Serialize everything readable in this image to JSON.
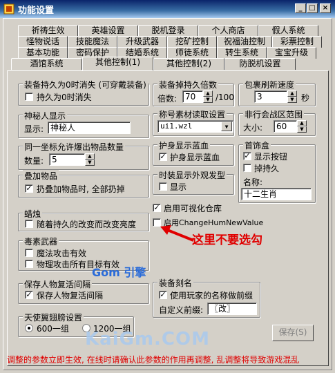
{
  "window": {
    "title": "功能设置"
  },
  "tabs_rows": [
    [
      "祈祷生效",
      "英雄设置",
      "脱机登录",
      "个人商店",
      "假人系统"
    ],
    [
      "怪物说话",
      "技能魔法",
      "升级武器",
      "挖矿控制",
      "祝福油控制",
      "彩票控制"
    ],
    [
      "基本功能",
      "密码保护",
      "结婚系统",
      "师徒系统",
      "转生系统",
      "宝宝升级"
    ],
    [
      "酒馆系统",
      "其他控制(1)",
      "其他控制(2)",
      "防脱机设置"
    ]
  ],
  "groups": {
    "durability": {
      "title": "装备持久为0时消失 (可穿戴装备)",
      "check_label": "持久为0时消失",
      "checked": false
    },
    "mystery": {
      "title": "神秘人显示",
      "label": "显示:",
      "value": "神秘人"
    },
    "same_coord": {
      "title": "同一坐标允许爆出物品数量",
      "label": "数量:",
      "value": "5"
    },
    "stack": {
      "title": "叠加物品",
      "check_label": "扔叠加物品时, 全部扔掉",
      "checked": true
    },
    "candle": {
      "title": "蜡烛",
      "check_label": "随着持久的改变而改变亮度",
      "checked": false
    },
    "poison": {
      "title": "毒素武器",
      "check1": "魔法攻击有效",
      "check1_checked": false,
      "check2": "物理攻击所有目标有效",
      "check2_checked": false
    },
    "revive": {
      "title": "保存人物复活间隔",
      "check_label": "保存人物复活间隔",
      "checked": true
    },
    "angel": {
      "title": "天使翼翅膀设置",
      "radio1": "600一组",
      "radio2": "1200一组",
      "selected": "600一组"
    },
    "drop_rate": {
      "title": "装备掉持久倍数",
      "label": "倍数:",
      "value": "70",
      "suffix": "/100"
    },
    "title_read": {
      "title": "称号素材读取设置",
      "value": "ui1.wzl"
    },
    "guard": {
      "title": "护身显示蓝血",
      "check_label": "护身显示蓝血",
      "checked": true
    },
    "fashion": {
      "title": "时装显示外观发型",
      "check_label": "显示",
      "checked": false
    },
    "pack_refresh": {
      "title": "包裹刷新速度",
      "value": "3",
      "unit": "秒"
    },
    "non_pk": {
      "title": "非行会战区范围",
      "label": "大小:",
      "value": "60"
    },
    "jewelry": {
      "title": "首饰盒",
      "check1": "显示按钮",
      "check1_checked": true,
      "check2": "掉持久",
      "check2_checked": false,
      "name_label": "名称:",
      "name_value": "十二生肖"
    },
    "engrave": {
      "title": "装备刻名",
      "check_label": "使用玩家的名称做前缀",
      "checked": true,
      "prefix_label": "自定义前缀:",
      "prefix_value": "〖改〗"
    }
  },
  "standalone": {
    "visual_storage": {
      "label": "启用可视化仓库",
      "checked": true
    },
    "change_hum": {
      "label": "启用ChangeHumNewValue",
      "checked": false
    }
  },
  "annotation": {
    "text": "这里不要选勾",
    "color": "#e00000"
  },
  "watermark1": "Gom 引擎",
  "watermark2": "KaiGm.COM",
  "save_label": "保存(S)",
  "bottom_note": "调整的参数立即生效, 在线时请确认此参数的作用再调整, 乱调整将导致游戏混乱"
}
